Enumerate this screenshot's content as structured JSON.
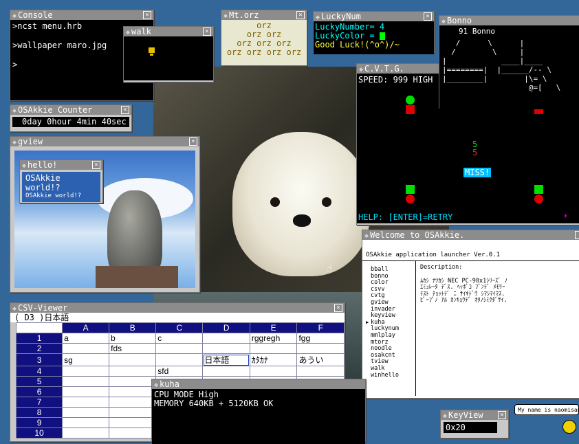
{
  "console": {
    "title": "Console",
    "lines": [
      ">ncst menu.hrb",
      "",
      ">wallpaper maro.jpg",
      "",
      ">"
    ]
  },
  "walk": {
    "title": "walk"
  },
  "mtorz": {
    "title": "Mt.orz",
    "lines": [
      "orz",
      "orz orz",
      "orz orz orz",
      "orz orz orz orz"
    ]
  },
  "luckynum": {
    "title": "LuckyNum",
    "line1": "LuckyNumber= 4",
    "line2": "LuckyColor = ",
    "line3": "Good Luck!(^o^)/~",
    "color_hex": "#00ff00"
  },
  "bonno": {
    "title": "Bonno",
    "count": "91 Bonno",
    "art": "   /      \\      |\n  /        \\     |\n|            ____|____\n|========|  |______/-- \\\n|________|        |\\= \\\n                   @=[   \\"
  },
  "cvtg": {
    "title": "C.V.T.G.",
    "speed": "SPEED:  999  HIGH",
    "n1": "5",
    "n2": "5",
    "miss": "MISS!",
    "help": "HELP: [ENTER]=RETRY",
    "star": "*"
  },
  "counter": {
    "title": "OSAkkie Counter",
    "value": "0day  0hour  4min 40sec"
  },
  "gview": {
    "title": "gview"
  },
  "hello": {
    "title": "hello!",
    "big": "OSAkkie world!?",
    "small": "OSAkkie world!?"
  },
  "launcher": {
    "title": "Welcome to OSAkkie.",
    "header": "OSAkkie application launcher  Ver.0.1",
    "desc_label": "Description:",
    "desc_lines": [
      "ﾑｶｼ ﾅﾂｶｼ NEC PC-98x1ｼﾘｰｽﾞ ﾉ",
      "ｴﾐｭﾚｰﾀ ﾃﾞｽ. ﾍｯﾎﾟｺ ﾌﾞﾝﾃﾞ ﾒﾓﾘｰ",
      "ﾃｽﾄ ﾁｮｯﾄﾃﾞ ﾆ ｻｲｷﾄﾞｳ ｼﾏｼﾏｲﾏｽ.",
      "ﾋﾟｰﾌﾟﾉ ｱﾙ ｶﾝｷｮｳﾃﾞ ｵﾀﾉｼﾐｸﾀﾞｻｲ."
    ],
    "apps": [
      "bball",
      "bonno",
      "color",
      "csvv",
      "cvtg",
      "gview",
      "invader",
      "keyview",
      "kuha",
      "luckynum",
      "mmlplay",
      "mtorz",
      "noodle",
      "osakcnt",
      "tview",
      "walk",
      "winhello"
    ],
    "selected_marker": "▶"
  },
  "csv": {
    "title": "CSV-Viewer",
    "cellref": "(    D3 )日本語",
    "cols": [
      "A",
      "B",
      "C",
      "D",
      "E",
      "F"
    ],
    "rows": [
      {
        "n": "1",
        "c": [
          "a",
          "b",
          "c",
          "",
          "rggregh",
          "fgg"
        ]
      },
      {
        "n": "2",
        "c": [
          "",
          "fds",
          "",
          "",
          "",
          ""
        ]
      },
      {
        "n": "3",
        "c": [
          "sg",
          "",
          "",
          "日本語",
          "ｶﾀｶﾅ",
          "あうい"
        ]
      },
      {
        "n": "4",
        "c": [
          "",
          "",
          "sfd",
          "",
          "",
          ""
        ]
      },
      {
        "n": "5",
        "c": [
          "",
          "",
          "",
          "",
          "",
          ""
        ]
      },
      {
        "n": "6",
        "c": [
          "",
          "",
          "",
          "",
          "",
          ""
        ]
      },
      {
        "n": "7",
        "c": [
          "",
          "",
          "",
          "",
          "",
          ""
        ]
      },
      {
        "n": "8",
        "c": [
          "",
          "",
          "",
          "",
          "",
          ""
        ]
      },
      {
        "n": "9",
        "c": [
          "",
          "",
          "",
          "",
          "",
          ""
        ]
      },
      {
        "n": "10",
        "c": [
          "",
          "",
          "",
          "",
          "",
          ""
        ]
      }
    ]
  },
  "kuha": {
    "title": "kuha",
    "line1": "CPU MODE  High",
    "line2": "MEMORY 640KB + 5120KB OK"
  },
  "keyview": {
    "title": "KeyView",
    "value": "0x20"
  },
  "balloon": {
    "text": "My name is naomisan."
  },
  "icons": {
    "close": "×",
    "title_icon": "❖",
    "cursor": "☝"
  }
}
